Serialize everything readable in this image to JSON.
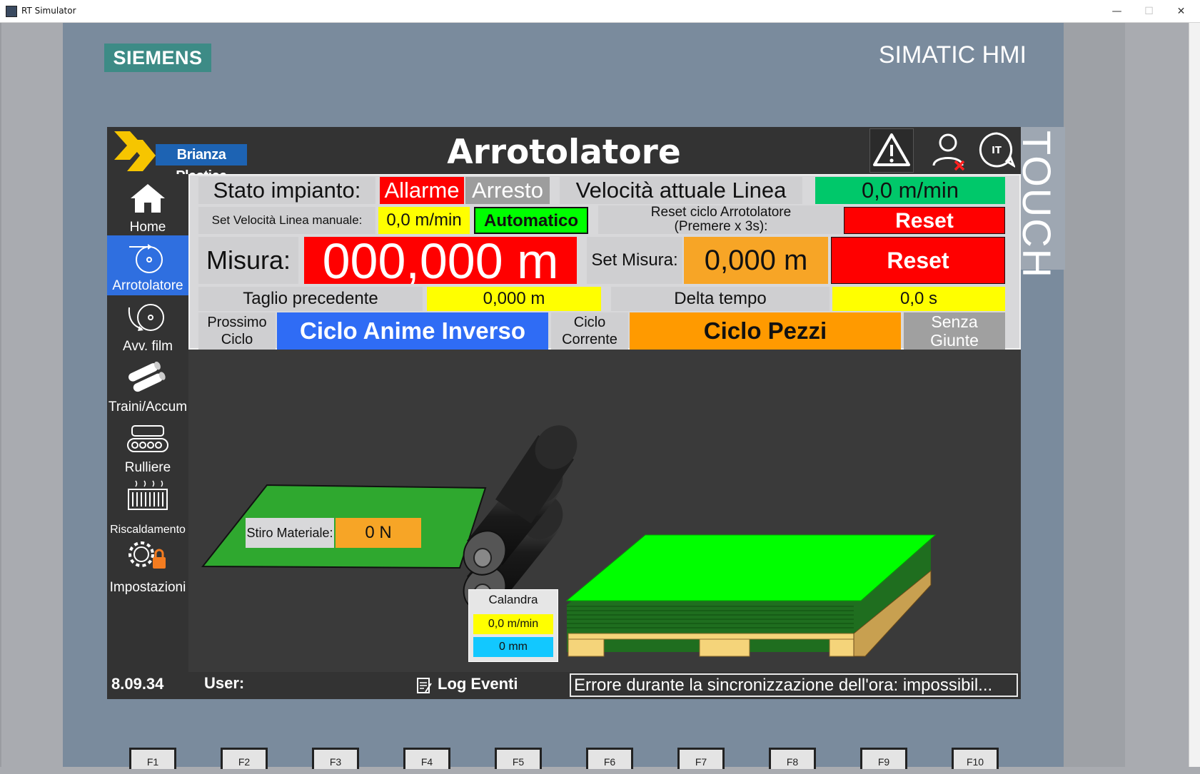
{
  "window": {
    "title": "RT Simulator",
    "minimize": "—",
    "maximize": "☐",
    "close": "✕"
  },
  "panel": {
    "brand": "SIEMENS",
    "model": "SIMATIC HMI",
    "touch": "TOUCH"
  },
  "header": {
    "logo_text": "Brianza Plastica",
    "title": "Arrotolatore",
    "lang": "IT"
  },
  "sidebar": {
    "items": [
      {
        "label": "Home"
      },
      {
        "label": "Arrotolatore"
      },
      {
        "label": "Avv. film"
      },
      {
        "label": "Traini/Accum"
      },
      {
        "label": "Rulliere"
      },
      {
        "label": "Riscaldamento"
      },
      {
        "label": "Impostazioni"
      }
    ]
  },
  "status": {
    "stato_label": "Stato impianto:",
    "allarme": "Allarme",
    "arresto": "Arresto",
    "vel_label": "Velocità attuale Linea",
    "vel_value": "0,0 m/min",
    "set_vel_label": "Set Velocità Linea manuale:",
    "set_vel_value": "0,0 m/min",
    "mode": "Automatico",
    "reset_ciclo_label": "Reset ciclo Arrotolatore (Premere x 3s):",
    "reset1": "Reset",
    "misura_label": "Misura:",
    "misura_value": "000,000 m",
    "set_misura_label": "Set Misura:",
    "set_misura_value": "0,000 m",
    "reset2": "Reset",
    "taglio_label": "Taglio precedente",
    "taglio_value": "0,000 m",
    "delta_label": "Delta tempo",
    "delta_value": "0,0 s",
    "prossimo_label_1": "Prossimo",
    "prossimo_label_2": "Ciclo",
    "prossimo_value": "Ciclo Anime Inverso",
    "corrente_label_1": "Ciclo",
    "corrente_label_2": "Corrente",
    "corrente_value": "Ciclo Pezzi",
    "giunte_1": "Senza",
    "giunte_2": "Giunte"
  },
  "process": {
    "stiro_label": "Stiro Materiale:",
    "stiro_value": "0 N",
    "calandra_label": "Calandra",
    "calandra_speed": "0,0 m/min",
    "calandra_gap": "0 mm"
  },
  "footer": {
    "version": "8.09.34",
    "user_label": "User:",
    "log_label": "Log Eventi",
    "message": "Errore durante la sincronizzazione dell'ora: impossibil..."
  },
  "fkeys": [
    "F1",
    "F2",
    "F3",
    "F4",
    "F5",
    "F6",
    "F7",
    "F8",
    "F9",
    "F10"
  ]
}
